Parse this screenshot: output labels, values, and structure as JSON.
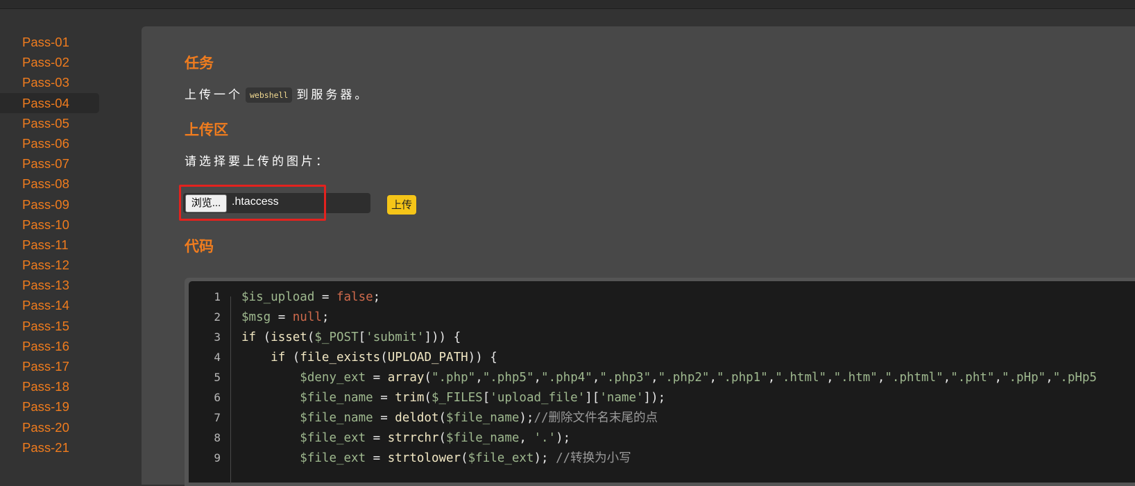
{
  "sidebar": {
    "items": [
      "Pass-01",
      "Pass-02",
      "Pass-03",
      "Pass-04",
      "Pass-05",
      "Pass-06",
      "Pass-07",
      "Pass-08",
      "Pass-09",
      "Pass-10",
      "Pass-11",
      "Pass-12",
      "Pass-13",
      "Pass-14",
      "Pass-15",
      "Pass-16",
      "Pass-17",
      "Pass-18",
      "Pass-19",
      "Pass-20",
      "Pass-21"
    ],
    "active_index": 3
  },
  "task": {
    "heading": "任务",
    "text_before": "上传一个",
    "inline_code": "webshell",
    "text_after": "到服务器。"
  },
  "upload": {
    "heading": "上传区",
    "prompt": "请选择要上传的图片：",
    "browse_label": "浏览...",
    "file_name": ".htaccess",
    "submit_label": "上传"
  },
  "code_section": {
    "heading": "代码",
    "lines": [
      {
        "n": "1",
        "text": "$is_upload = false;"
      },
      {
        "n": "2",
        "text": "$msg = null;"
      },
      {
        "n": "3",
        "text": "if (isset($_POST['submit'])) {"
      },
      {
        "n": "4",
        "text": "    if (file_exists(UPLOAD_PATH)) {"
      },
      {
        "n": "5",
        "text": "        $deny_ext = array(\".php\",\".php5\",\".php4\",\".php3\",\".php2\",\".php1\",\".html\",\".htm\",\".phtml\",\".pht\",\".pHp\",\".pHp5"
      },
      {
        "n": "6",
        "text": "        $file_name = trim($_FILES['upload_file']['name']);"
      },
      {
        "n": "7",
        "text": "        $file_name = deldot($file_name);//删除文件名末尾的点"
      },
      {
        "n": "8",
        "text": "        $file_ext = strrchr($file_name, '.');"
      },
      {
        "n": "9",
        "text": "        $file_ext = strtolower($file_ext); //转换为小写"
      }
    ]
  },
  "colors": {
    "accent": "#f07c1e",
    "submit": "#f5c518",
    "highlight": "#e3221e"
  }
}
